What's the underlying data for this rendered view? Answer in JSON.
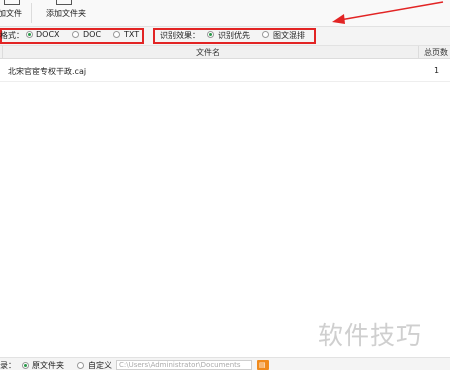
{
  "toolbar": {
    "add_file_label": "加文件",
    "add_folder_label": "添加文件夹"
  },
  "output_format": {
    "label": "格式：",
    "options": [
      "DOCX",
      "DOC",
      "TXT"
    ],
    "selected": "DOCX"
  },
  "recognition": {
    "label": "识别效果：",
    "options": [
      "识别优先",
      "图文混排"
    ],
    "selected": "识别优先"
  },
  "table": {
    "columns": [
      "文件名",
      "总页数"
    ],
    "rows": [
      {
        "filename": "北宋官宦专权干政.caj",
        "pages": "1"
      }
    ]
  },
  "output_dir": {
    "label": "录：",
    "options": [
      "原文件夹",
      "自定义"
    ],
    "selected": "原文件夹",
    "path_value": "C:\\Users\\Administrator\\Documents"
  },
  "watermark": "软件技巧",
  "colors": {
    "highlight_box": "#e22424",
    "radio_selected": "#2a9a4a",
    "folder_button": "#f08a1c"
  }
}
